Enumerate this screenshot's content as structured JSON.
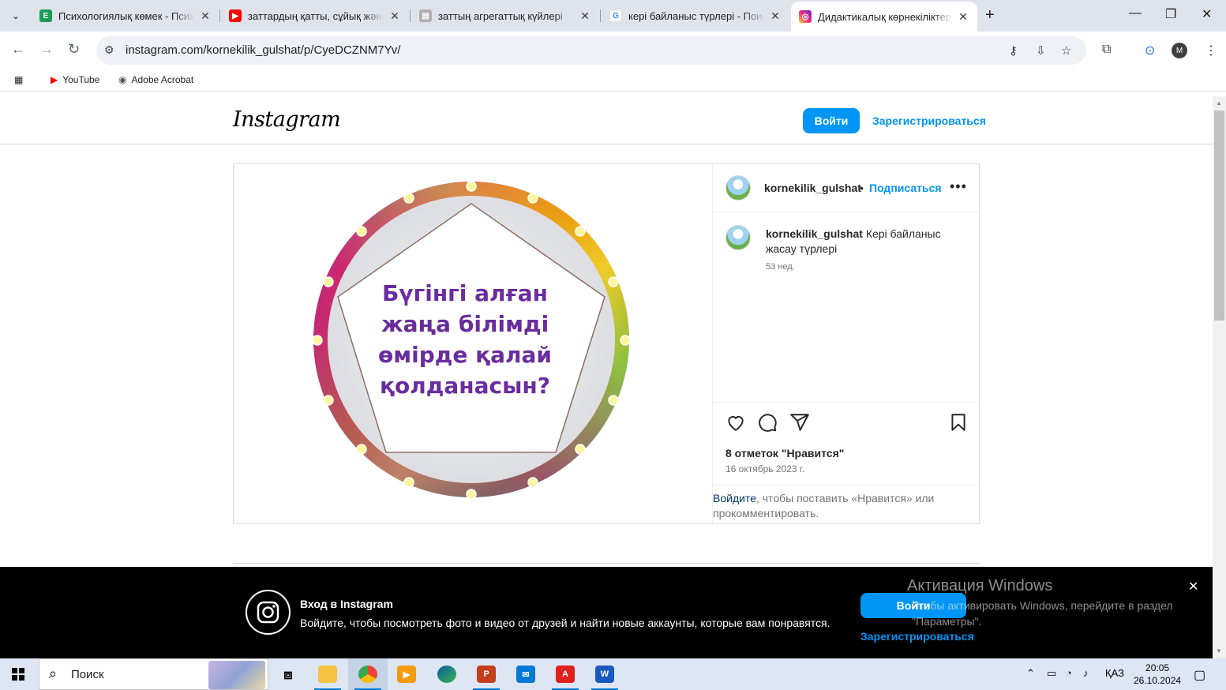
{
  "tabs": [
    {
      "title": "Психологиялық көмек - Психо",
      "favicon": "book-icon",
      "color": "#1a9e55",
      "active": false
    },
    {
      "title": "заттардың қатты, сұйық және г",
      "favicon": "youtube-icon",
      "color": "#ff0000",
      "active": false
    },
    {
      "title": "заттың агрегаттық күйлері",
      "favicon": "doc-icon",
      "color": "#8a8a8a",
      "active": false
    },
    {
      "title": "кері байланыс түрлері - Поиск",
      "favicon": "google-icon",
      "color": "#4285f4",
      "active": false
    },
    {
      "title": "Дидактикалық көрнекіліктері (",
      "favicon": "instagram-icon",
      "color": "#d6249f",
      "active": true
    }
  ],
  "address_bar": {
    "url": "instagram.com/kornekilik_gulshat/p/CyeDCZNM7Yv/"
  },
  "profile_initial": "M",
  "bookmarks": [
    {
      "label": "YouTube",
      "icon": "youtube-icon"
    },
    {
      "label": "Adobe Acrobat",
      "icon": "globe-icon"
    }
  ],
  "instagram": {
    "logo": "Instagram",
    "login_label": "Войти",
    "signup_label": "Зарегистрироваться"
  },
  "post": {
    "image_lines": [
      "Бүгінгі алған",
      "жаңа білімді",
      "өмірде қалай",
      "қолданасын?"
    ],
    "username": "kornekilik_gulshat",
    "follow_label": "Подписаться",
    "caption_text": "Кері байланыс жасау түрлері",
    "caption_time": "53 нед.",
    "likes": "8 отметок \"Нравится\"",
    "date": "16 октябрь 2023 г.",
    "login_link": "Войдите",
    "login_rest": ", чтобы поставить «Нравится» или прокомментировать."
  },
  "banner": {
    "title": "Вход в Instagram",
    "text": "Войдите, чтобы посмотреть фото и видео от друзей и найти новые аккаунты, которые вам понравятся.",
    "login_label": "Войти",
    "signup_label": "Зарегистрироваться"
  },
  "activation": {
    "title": "Активация Windows",
    "text": "Чтобы активировать Windows, перейдите в раздел \"Параметры\"."
  },
  "taskbar": {
    "search_placeholder": "Поиск",
    "language": "ҚАЗ",
    "time": "20:05",
    "date": "26.10.2024"
  }
}
